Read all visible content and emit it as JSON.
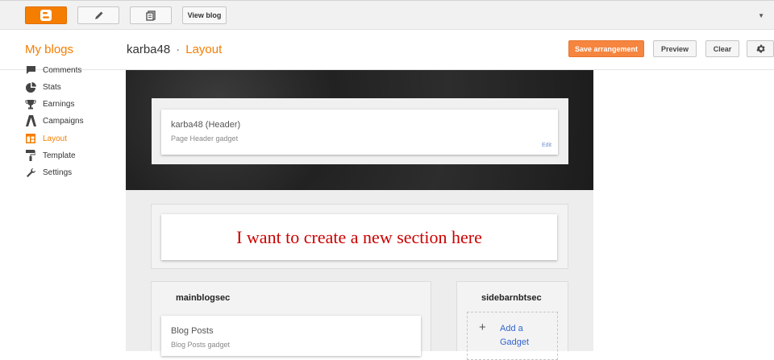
{
  "toolbar": {
    "view_blog_label": "View blog",
    "dropdown_icon": "caret-down-icon"
  },
  "header": {
    "my_blogs_label": "My blogs",
    "blog_name": "karba48",
    "separator": "·",
    "page_name": "Layout",
    "save_label": "Save arrangement",
    "preview_label": "Preview",
    "clear_label": "Clear",
    "settings_icon": "gear-icon"
  },
  "sidebar": {
    "items": [
      {
        "label": "Comments",
        "icon": "comment-icon"
      },
      {
        "label": "Stats",
        "icon": "pie-chart-icon"
      },
      {
        "label": "Earnings",
        "icon": "trophy-icon"
      },
      {
        "label": "Campaigns",
        "icon": "campaign-icon"
      },
      {
        "label": "Layout",
        "icon": "layout-icon",
        "active": true
      },
      {
        "label": "Template",
        "icon": "paint-roller-icon"
      },
      {
        "label": "Settings",
        "icon": "wrench-icon"
      }
    ]
  },
  "layout": {
    "header_gadget_title": "karba48 (Header)",
    "header_gadget_type": "Page Header gadget",
    "header_edit_label": "Edit",
    "annotation_text": "I want to create a new section here",
    "main_section_title": "mainblogsec",
    "blog_posts_title": "Blog Posts",
    "blog_posts_type": "Blog Posts gadget",
    "sidebar_section_title": "sidebarnbtsec",
    "add_gadget_label": "Add a Gadget"
  },
  "colors": {
    "accent": "#f57d00",
    "save_button": "#f5853f",
    "annotation": "#cc0000",
    "link": "#3366cc"
  }
}
